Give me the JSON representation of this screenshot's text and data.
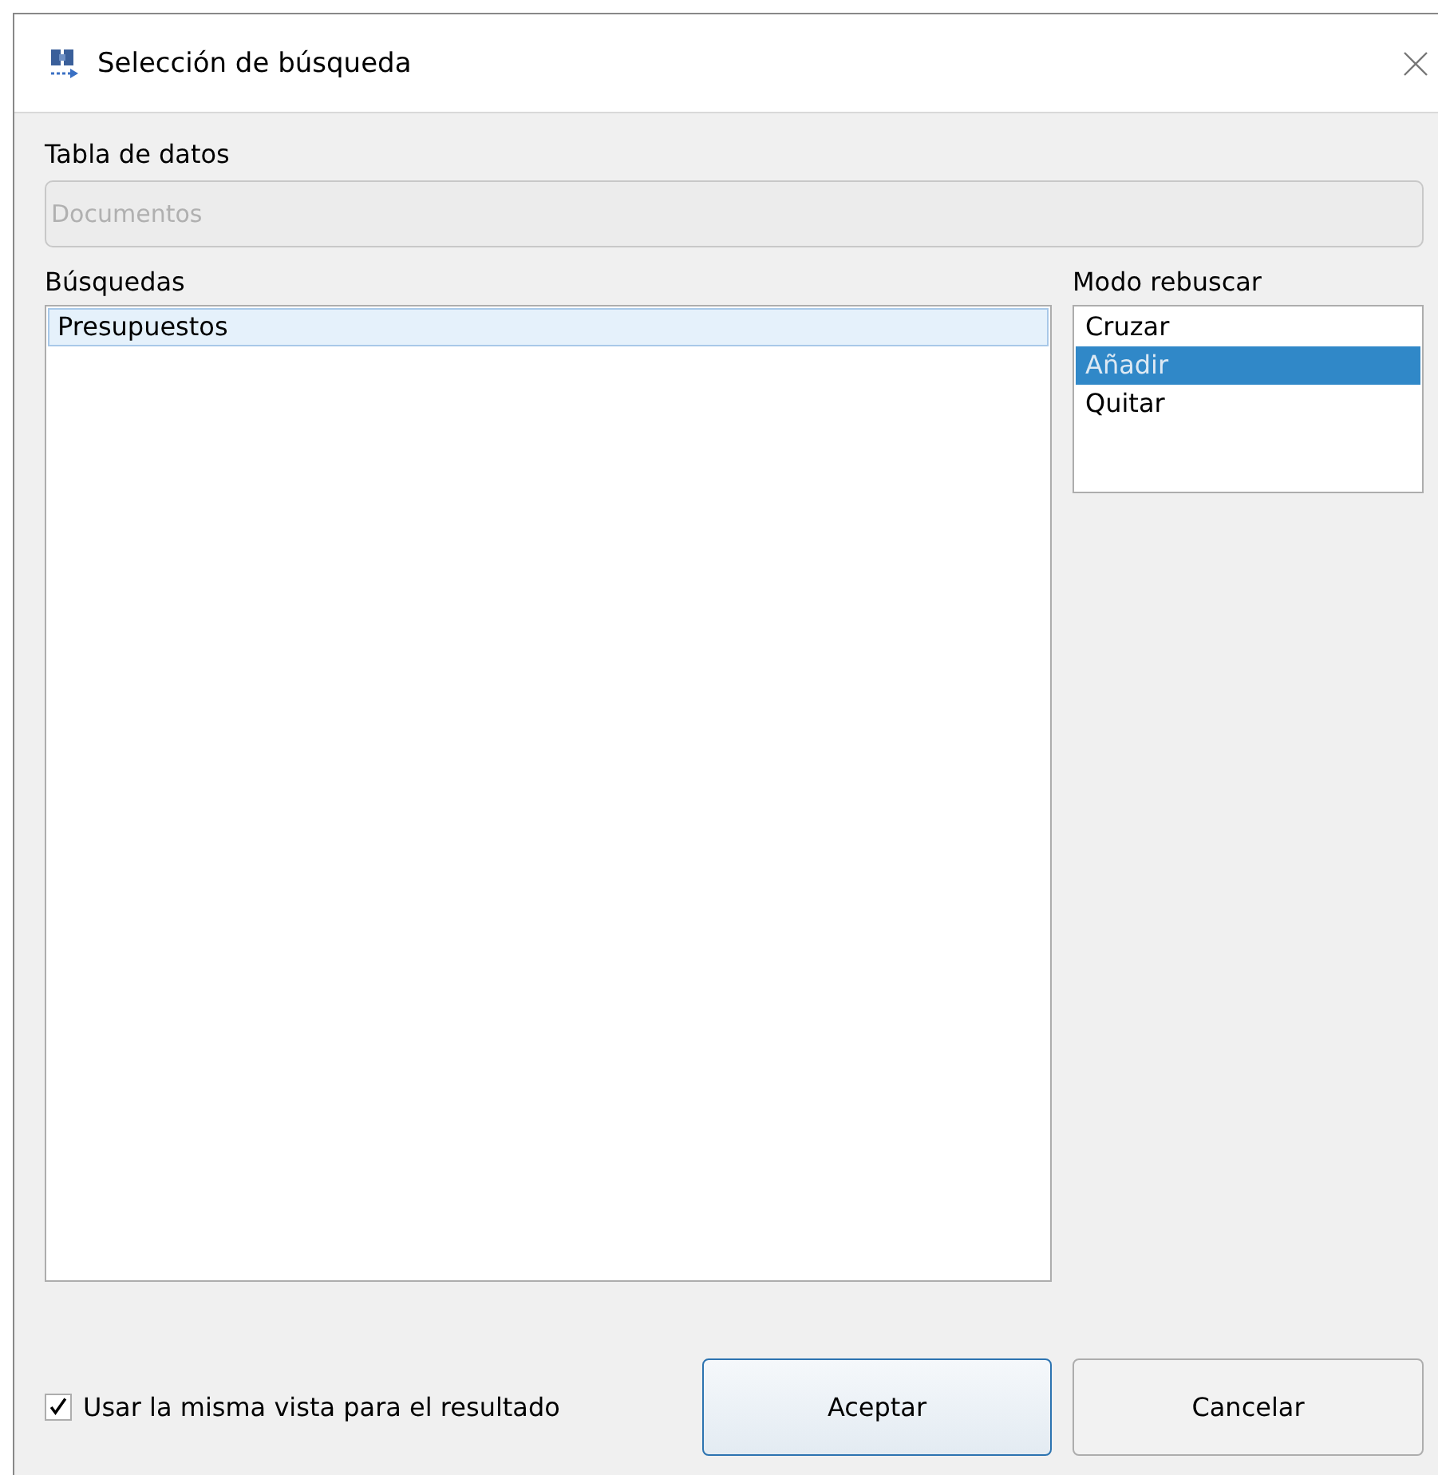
{
  "window": {
    "title": "Selección de búsqueda"
  },
  "data_table": {
    "label": "Tabla de datos",
    "value": "Documentos",
    "disabled": true
  },
  "searches": {
    "label": "Búsquedas",
    "items": [
      {
        "label": "Presupuestos",
        "selected": true
      }
    ]
  },
  "research_mode": {
    "label": "Modo rebuscar",
    "items": [
      {
        "label": "Cruzar",
        "selected": false
      },
      {
        "label": "Añadir",
        "selected": true
      },
      {
        "label": "Quitar",
        "selected": false
      }
    ]
  },
  "same_view": {
    "label": "Usar la misma vista para el resultado",
    "checked": true
  },
  "buttons": [
    {
      "label": "Aceptar",
      "default": true
    },
    {
      "label": "Cancelar",
      "default": false
    }
  ]
}
